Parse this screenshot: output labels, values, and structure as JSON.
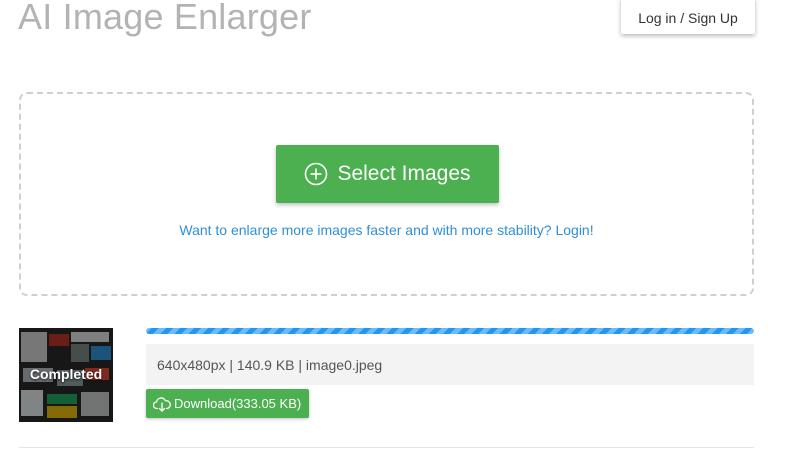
{
  "header": {
    "title": "AI Image Enlarger",
    "login_label": "Log in / Sign Up"
  },
  "upload": {
    "select_label": "Select Images",
    "select_icon": "plus-circle-icon",
    "promo_text": "Want to enlarge more images faster and with more stability? Login!"
  },
  "file": {
    "status": "Completed",
    "progress": 1.0,
    "info": "640x480px | 140.9 KB | image0.jpeg",
    "download_label": "Download(333.05 KB)",
    "download_icon": "cloud-download-icon"
  },
  "colors": {
    "title": "#b3b3b3",
    "primary_green": "#4caf50",
    "link_blue": "#2f8fd8",
    "progress_blue": "#2196f3",
    "dashed_border": "#cfcfcf"
  }
}
